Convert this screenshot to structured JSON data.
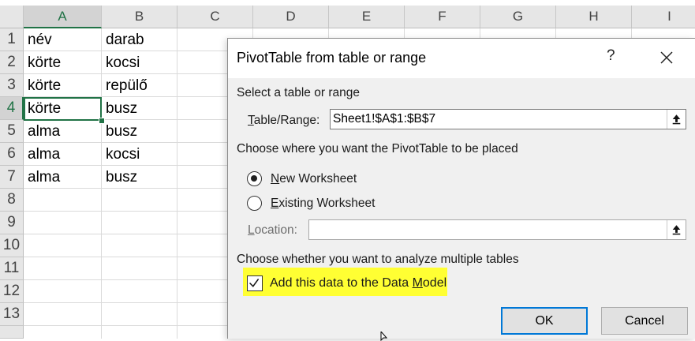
{
  "spreadsheet": {
    "columns": [
      "A",
      "B",
      "C",
      "D",
      "E",
      "F",
      "G",
      "H",
      "I"
    ],
    "rows": [
      "1",
      "2",
      "3",
      "4",
      "5",
      "6",
      "7",
      "8",
      "9",
      "10",
      "11",
      "12",
      "13"
    ],
    "active_column": "A",
    "active_row": "4",
    "cells": {
      "A1": "név",
      "B1": "darab",
      "A2": "körte",
      "B2": "kocsi",
      "A3": "körte",
      "B3": "repülő",
      "A4": "körte",
      "B4": "busz",
      "A5": "alma",
      "B5": "busz",
      "A6": "alma",
      "B6": "kocsi",
      "A7": "alma",
      "B7": "busz"
    },
    "selection_color": "#217346"
  },
  "dialog": {
    "title": "PivotTable from table or range",
    "help_label": "?",
    "section_source": "Select a table or range",
    "table_range_label_u": "T",
    "table_range_label_rest": "able/Range:",
    "table_range_value": "Sheet1!$A$1:$B$7",
    "section_placement": "Choose where you want the PivotTable to be placed",
    "new_ws_u": "N",
    "new_ws_rest": "ew Worksheet",
    "existing_ws_u": "E",
    "existing_ws_rest": "xisting Worksheet",
    "placement_selected": "New Worksheet",
    "location_u": "L",
    "location_rest": "ocation:",
    "location_value": "",
    "section_multiple": "Choose whether you want to analyze multiple tables",
    "data_model_pre": "Add this data to the Data ",
    "data_model_u": "M",
    "data_model_post": "odel",
    "data_model_checked": true,
    "highlight_color": "#ffff33",
    "ok_label": "OK",
    "cancel_label": "Cancel",
    "default_button_color": "#0078d7",
    "icons": [
      "close-icon",
      "range-picker-icon",
      "check-icon",
      "mouse-cursor-icon"
    ]
  }
}
